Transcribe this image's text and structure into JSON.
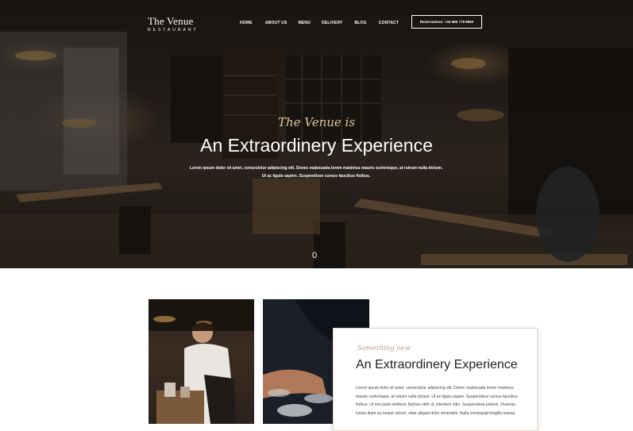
{
  "brand": {
    "name": "The Venue",
    "tagline": "RESTAURANT"
  },
  "nav": {
    "items": [
      "HOME",
      "ABOUT US",
      "MENU",
      "DELIVERY",
      "BLOG",
      "CONTACT"
    ]
  },
  "reservation": {
    "label": "Reservations: +34 586 778 8892"
  },
  "hero": {
    "script": "The Venue is",
    "title": "An Extraordinery Experience",
    "text": "Lorem ipsum dolor sit amet, consectetur adipiscing elit. Donec malesuada lorem maximus mauris scelerisque, at rutrum nulla dictum. Ut ac ligula sapien. Suspendisse cursus faucibus finibus.",
    "indicator": "0"
  },
  "about": {
    "script": "Something new",
    "title": "An Extraordinery Experience",
    "text": "Lorem ipsum dolor sit amet, consectetur adipiscing elit. Donec malesuada lorem maximus mauris scelerisque, at rutrum nulla dictum. Ut ac ligula sapien. Suspendisse cursus faucibus finibus. Ut non justo eleifend, facilisis nibh ut, interdum odio. Suspendisse potenti. Vivamus luctus diam eu neque rutrum, vitae aliquet dolor venenatis. Nulla consequat fringilla massa."
  },
  "colors": {
    "accent_script": "#e4c6a6",
    "card_script": "#c79a86",
    "card_border": "#e6d9cf"
  }
}
